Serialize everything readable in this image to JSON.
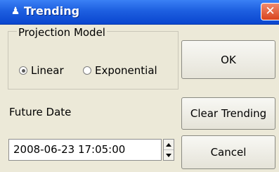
{
  "window": {
    "title": "Trending",
    "close_glyph": "✕"
  },
  "projection": {
    "group_title": "Projection Model",
    "options": [
      {
        "label": "Linear",
        "selected": true
      },
      {
        "label": "Exponential",
        "selected": false
      }
    ]
  },
  "future": {
    "label": "Future Date",
    "value": "2008-06-23 17:05:00"
  },
  "buttons": {
    "ok": "OK",
    "clear": "Clear Trending",
    "cancel": "Cancel"
  },
  "colors": {
    "titlebar": "#1d5fe0",
    "close": "#d9431c",
    "window_bg": "#ece9d8"
  }
}
